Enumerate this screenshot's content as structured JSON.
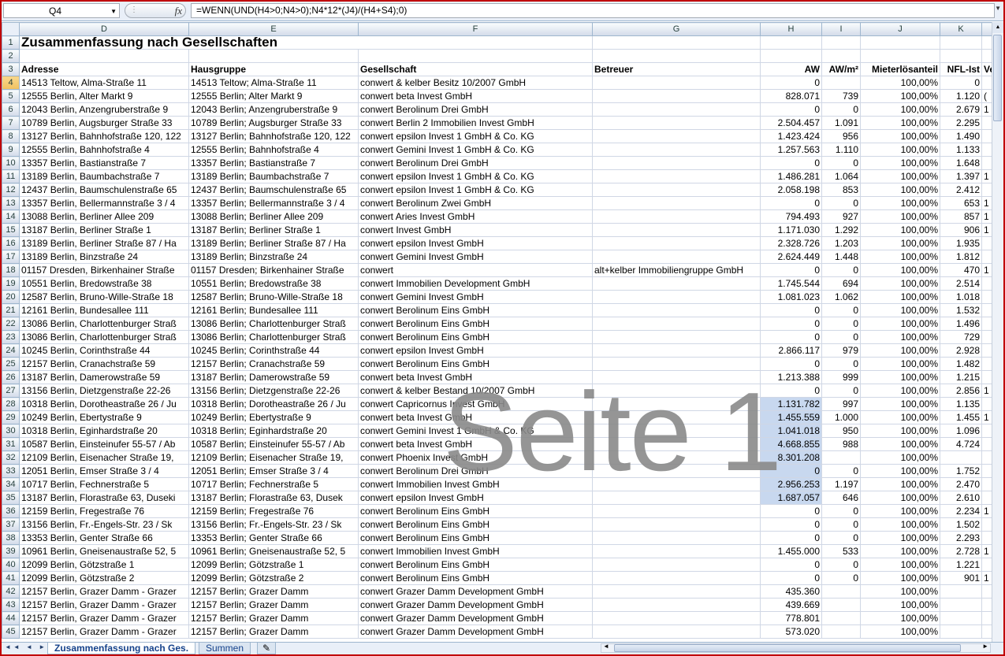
{
  "formula_bar": {
    "cell_ref": "Q4",
    "fx_label": "fx",
    "formula": "=WENN(UND(H4>0;N4>0);N4*12*(J4)/(H4+S4);0)"
  },
  "columns": [
    "D",
    "E",
    "F",
    "G",
    "H",
    "I",
    "J",
    "K"
  ],
  "row_numbers": [
    "1",
    "2",
    "3",
    "4",
    "5",
    "6",
    "7",
    "8",
    "9",
    "10",
    "11",
    "12",
    "13",
    "14",
    "15",
    "16",
    "17",
    "18",
    "19",
    "20",
    "21",
    "22",
    "23",
    "24",
    "25",
    "26",
    "27",
    "28",
    "29",
    "30",
    "31",
    "32",
    "33",
    "34",
    "35",
    "36",
    "37",
    "38",
    "39",
    "40",
    "41",
    "42",
    "43",
    "44",
    "45"
  ],
  "title": "Zusammenfassung nach Gesellschaften",
  "headers": {
    "adresse": "Adresse",
    "hausgruppe": "Hausgruppe",
    "gesellschaft": "Gesellschaft",
    "betreuer": "Betreuer",
    "aw": "AW",
    "awm2": "AW/m²",
    "mieter": "Mieterlösanteil",
    "nfl": "NFL-Ist",
    "partial": "Ve"
  },
  "rows": [
    [
      "14513 Teltow, Alma-Straße 11",
      "14513 Teltow; Alma-Straße 11",
      "conwert & kelber Besitz 10/2007 GmbH",
      "",
      "0",
      "",
      "100,00%",
      "0",
      ""
    ],
    [
      "12555 Berlin, Alter Markt 9",
      "12555 Berlin; Alter Markt 9",
      "conwert beta Invest GmbH",
      "",
      "828.071",
      "739",
      "100,00%",
      "1.120",
      "("
    ],
    [
      "12043 Berlin, Anzengruberstraße 9",
      "12043 Berlin; Anzengruberstraße 9",
      "conwert Berolinum Drei GmbH",
      "",
      "0",
      "0",
      "100,00%",
      "2.679",
      "1"
    ],
    [
      "10789 Berlin, Augsburger Straße 33",
      "10789 Berlin; Augsburger Straße 33",
      "conwert Berlin 2 Immobilien Invest GmbH",
      "",
      "2.504.457",
      "1.091",
      "100,00%",
      "2.295",
      ""
    ],
    [
      "13127 Berlin, Bahnhofstraße 120, 122",
      "13127 Berlin; Bahnhofstraße 120, 122",
      "conwert epsilon Invest 1 GmbH & Co. KG",
      "",
      "1.423.424",
      "956",
      "100,00%",
      "1.490",
      ""
    ],
    [
      "12555 Berlin, Bahnhofstraße 4",
      "12555 Berlin; Bahnhofstraße 4",
      "conwert Gemini Invest 1 GmbH & Co. KG",
      "",
      "1.257.563",
      "1.110",
      "100,00%",
      "1.133",
      ""
    ],
    [
      "13357 Berlin, Bastianstraße 7",
      "13357 Berlin; Bastianstraße 7",
      "conwert Berolinum Drei GmbH",
      "",
      "0",
      "0",
      "100,00%",
      "1.648",
      ""
    ],
    [
      "13189 Berlin, Baumbachstraße 7",
      "13189 Berlin; Baumbachstraße 7",
      "conwert epsilon Invest 1 GmbH & Co. KG",
      "",
      "1.486.281",
      "1.064",
      "100,00%",
      "1.397",
      "1"
    ],
    [
      "12437 Berlin, Baumschulenstraße 65",
      "12437 Berlin; Baumschulenstraße 65",
      "conwert epsilon Invest 1 GmbH & Co. KG",
      "",
      "2.058.198",
      "853",
      "100,00%",
      "2.412",
      ""
    ],
    [
      "13357 Berlin, Bellermannstraße 3 / 4",
      "13357 Berlin; Bellermannstraße 3 / 4",
      "conwert Berolinum Zwei GmbH",
      "",
      "0",
      "0",
      "100,00%",
      "653",
      "1"
    ],
    [
      "13088 Berlin, Berliner Allee 209",
      "13088 Berlin; Berliner Allee 209",
      "conwert Aries Invest GmbH",
      "",
      "794.493",
      "927",
      "100,00%",
      "857",
      "1"
    ],
    [
      "13187 Berlin, Berliner Straße 1",
      "13187 Berlin; Berliner Straße 1",
      "conwert Invest GmbH",
      "",
      "1.171.030",
      "1.292",
      "100,00%",
      "906",
      "1"
    ],
    [
      "13189 Berlin, Berliner Straße 87 / Ha",
      "13189 Berlin; Berliner Straße 87 / Ha",
      "conwert epsilon Invest GmbH",
      "",
      "2.328.726",
      "1.203",
      "100,00%",
      "1.935",
      ""
    ],
    [
      "13189 Berlin, Binzstraße 24",
      "13189 Berlin; Binzstraße 24",
      "conwert Gemini Invest GmbH",
      "",
      "2.624.449",
      "1.448",
      "100,00%",
      "1.812",
      ""
    ],
    [
      "01157 Dresden, Birkenhainer Straße",
      "01157 Dresden; Birkenhainer Straße",
      "conwert",
      "alt+kelber Immobiliengruppe GmbH",
      "0",
      "0",
      "100,00%",
      "470",
      "1"
    ],
    [
      "10551 Berlin, Bredowstraße 38",
      "10551 Berlin; Bredowstraße 38",
      "conwert Immobilien Development GmbH",
      "",
      "1.745.544",
      "694",
      "100,00%",
      "2.514",
      ""
    ],
    [
      "12587 Berlin, Bruno-Wille-Straße 18",
      "12587 Berlin; Bruno-Wille-Straße 18",
      "conwert Gemini Invest GmbH",
      "",
      "1.081.023",
      "1.062",
      "100,00%",
      "1.018",
      ""
    ],
    [
      "12161 Berlin, Bundesallee 111",
      "12161 Berlin; Bundesallee 111",
      "conwert Berolinum Eins GmbH",
      "",
      "0",
      "0",
      "100,00%",
      "1.532",
      ""
    ],
    [
      "13086 Berlin, Charlottenburger Straß",
      "13086 Berlin; Charlottenburger Straß",
      "conwert Berolinum Eins GmbH",
      "",
      "0",
      "0",
      "100,00%",
      "1.496",
      ""
    ],
    [
      "13086 Berlin, Charlottenburger Straß",
      "13086 Berlin; Charlottenburger Straß",
      "conwert Berolinum Eins GmbH",
      "",
      "0",
      "0",
      "100,00%",
      "729",
      ""
    ],
    [
      "10245 Berlin, Corinthstraße 44",
      "10245 Berlin; Corinthstraße 44",
      "conwert epsilon Invest GmbH",
      "",
      "2.866.117",
      "979",
      "100,00%",
      "2.928",
      ""
    ],
    [
      "12157 Berlin, Cranachstraße 59",
      "12157 Berlin; Cranachstraße 59",
      "conwert Berolinum Eins GmbH",
      "",
      "0",
      "0",
      "100,00%",
      "1.482",
      ""
    ],
    [
      "13187 Berlin, Damerowstraße 59",
      "13187 Berlin; Damerowstraße 59",
      "conwert beta Invest GmbH",
      "",
      "1.213.388",
      "999",
      "100,00%",
      "1.215",
      ""
    ],
    [
      "13156 Berlin, Dietzgenstraße 22-26",
      "13156 Berlin; Dietzgenstraße 22-26",
      "conwert & kelber Bestand 10/2007 GmbH",
      "",
      "0",
      "0",
      "100,00%",
      "2.856",
      "1"
    ],
    [
      "10318 Berlin, Dorotheastraße 26 / Ju",
      "10318 Berlin; Dorotheastraße 26 / Ju",
      "conwert Capricornus Invest GmbH",
      "",
      "1.131.782",
      "997",
      "100,00%",
      "1.135",
      ""
    ],
    [
      "10249 Berlin, Ebertystraße 9",
      "10249 Berlin; Ebertystraße 9",
      "conwert beta Invest GmbH",
      "",
      "1.455.559",
      "1.000",
      "100,00%",
      "1.455",
      "1"
    ],
    [
      "10318 Berlin, Eginhardstraße 20",
      "10318 Berlin; Eginhardstraße 20",
      "conwert Gemini Invest 1 GmbH & Co. KG",
      "",
      "1.041.018",
      "950",
      "100,00%",
      "1.096",
      ""
    ],
    [
      "10587 Berlin, Einsteinufer 55-57 / Ab",
      "10587 Berlin; Einsteinufer 55-57 / Ab",
      "conwert beta Invest GmbH",
      "",
      "4.668.855",
      "988",
      "100,00%",
      "4.724",
      ""
    ],
    [
      "12109 Berlin, Eisenacher Straße 19,",
      "12109 Berlin; Eisenacher Straße 19,",
      "conwert Phoenix Invest GmbH",
      "",
      "8.301.208",
      "",
      "100,00%",
      "",
      ""
    ],
    [
      "12051 Berlin, Emser Straße 3 / 4",
      "12051 Berlin; Emser Straße 3 / 4",
      "conwert Berolinum Drei GmbH",
      "",
      "0",
      "0",
      "100,00%",
      "1.752",
      ""
    ],
    [
      "10717 Berlin, Fechnerstraße 5",
      "10717 Berlin; Fechnerstraße 5",
      "conwert Immobilien Invest GmbH",
      "",
      "2.956.253",
      "1.197",
      "100,00%",
      "2.470",
      ""
    ],
    [
      "13187 Berlin, Florastraße 63, Duseki",
      "13187 Berlin; Florastraße 63, Dusek",
      "conwert epsilon Invest GmbH",
      "",
      "1.687.057",
      "646",
      "100,00%",
      "2.610",
      ""
    ],
    [
      "12159 Berlin, Fregestraße 76",
      "12159 Berlin; Fregestraße 76",
      "conwert Berolinum Eins GmbH",
      "",
      "0",
      "0",
      "100,00%",
      "2.234",
      "1"
    ],
    [
      "13156 Berlin, Fr.-Engels-Str. 23 / Sk",
      "13156 Berlin; Fr.-Engels-Str. 23 / Sk",
      "conwert Berolinum Eins GmbH",
      "",
      "0",
      "0",
      "100,00%",
      "1.502",
      ""
    ],
    [
      "13353 Berlin, Genter Straße 66",
      "13353 Berlin; Genter Straße 66",
      "conwert Berolinum Eins GmbH",
      "",
      "0",
      "0",
      "100,00%",
      "2.293",
      ""
    ],
    [
      "10961 Berlin, Gneisenaustraße 52, 5",
      "10961 Berlin; Gneisenaustraße 52, 5",
      "conwert Immobilien Invest GmbH",
      "",
      "1.455.000",
      "533",
      "100,00%",
      "2.728",
      "1"
    ],
    [
      "12099 Berlin, Götzstraße 1",
      "12099 Berlin; Götzstraße 1",
      "conwert Berolinum Eins GmbH",
      "",
      "0",
      "0",
      "100,00%",
      "1.221",
      ""
    ],
    [
      "12099 Berlin, Götzstraße 2",
      "12099 Berlin; Götzstraße 2",
      "conwert Berolinum Eins GmbH",
      "",
      "0",
      "0",
      "100,00%",
      "901",
      "1"
    ],
    [
      "12157 Berlin, Grazer Damm - Grazer",
      "12157 Berlin; Grazer Damm",
      "conwert Grazer Damm Development GmbH",
      "",
      "435.360",
      "",
      "100,00%",
      "",
      ""
    ],
    [
      "12157 Berlin, Grazer Damm - Grazer",
      "12157 Berlin; Grazer Damm",
      "conwert Grazer Damm Development GmbH",
      "",
      "439.669",
      "",
      "100,00%",
      "",
      ""
    ],
    [
      "12157 Berlin, Grazer Damm - Grazer",
      "12157 Berlin; Grazer Damm",
      "conwert Grazer Damm Development GmbH",
      "",
      "778.801",
      "",
      "100,00%",
      "",
      ""
    ],
    [
      "12157 Berlin, Grazer Damm - Grazer",
      "12157 Berlin; Grazer Damm",
      "conwert Grazer Damm Development GmbH",
      "",
      "573.020",
      "",
      "100,00%",
      "",
      ""
    ]
  ],
  "watermark": "Seite 1",
  "sheet_tabs": [
    "Zusammenfassung nach Ges.",
    "Summen"
  ],
  "tab_nav": "◄◄ ◄ ► ►►"
}
